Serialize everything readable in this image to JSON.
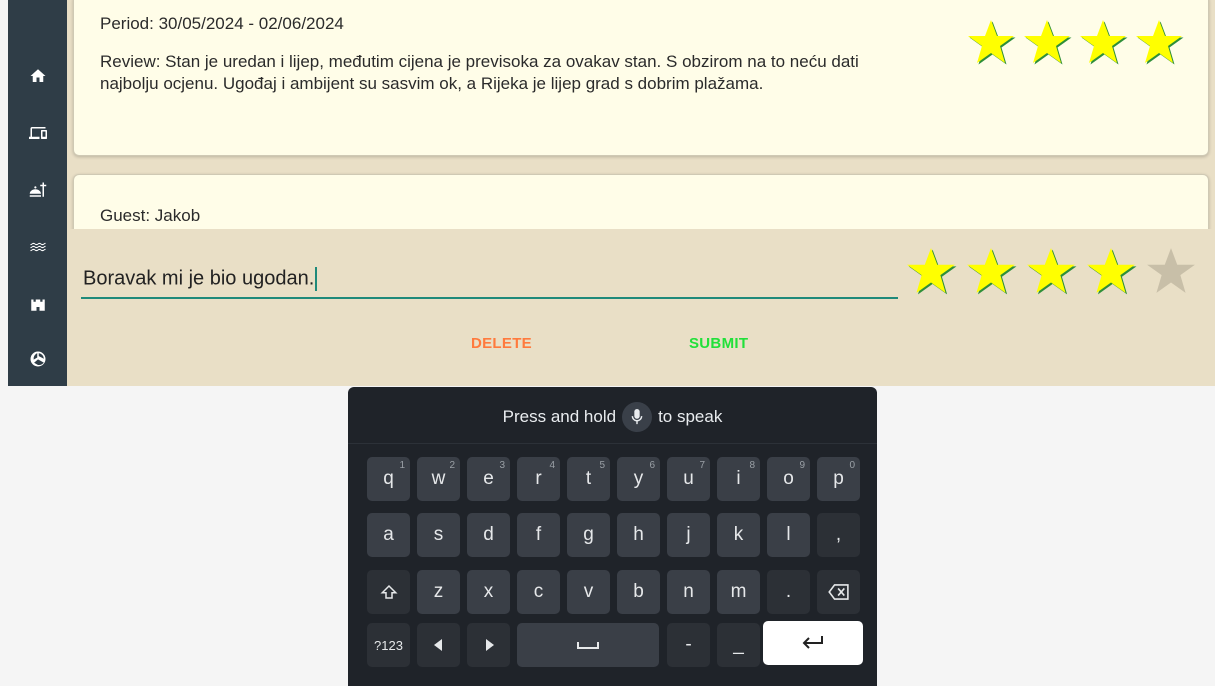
{
  "sidebar": {
    "icons": [
      "home-icon",
      "devices-icon",
      "restaurant-icon",
      "waves-icon",
      "castle-icon",
      "volleyball-icon"
    ]
  },
  "reviews": [
    {
      "period": "Period: 30/05/2024 - 02/06/2024",
      "review": "Review: Stan je uredan i lijep, međutim cijena je previsoka za ovakav stan. S obzirom na to neću dati najbolju ocjenu. Ugođaj i ambijent su sasvim ok, a Rijeka je lijep grad s dobrim plažama.",
      "rating": 4
    },
    {
      "guest": "Guest: Jakob"
    }
  ],
  "composer": {
    "text": "Boravak mi je bio ugodan.",
    "rating": 4,
    "max_rating": 5,
    "delete_label": "DELETE",
    "submit_label": "SUBMIT"
  },
  "colors": {
    "star_active": "#ffff00",
    "star_inactive": "#c8bfa8",
    "delete": "#ff7a3d",
    "submit": "#22e03a",
    "accent": "#1f8a7a"
  },
  "keyboard": {
    "hint_before": "Press and hold",
    "hint_after": "to speak",
    "row1": [
      [
        "q",
        "1"
      ],
      [
        "w",
        "2"
      ],
      [
        "e",
        "3"
      ],
      [
        "r",
        "4"
      ],
      [
        "t",
        "5"
      ],
      [
        "y",
        "6"
      ],
      [
        "u",
        "7"
      ],
      [
        "i",
        "8"
      ],
      [
        "o",
        "9"
      ],
      [
        "p",
        "0"
      ]
    ],
    "row2": [
      "a",
      "s",
      "d",
      "f",
      "g",
      "h",
      "j",
      "k",
      "l",
      ","
    ],
    "row3": [
      "z",
      "x",
      "c",
      "v",
      "b",
      "n",
      "m",
      "."
    ],
    "symbols_label": "?123",
    "dash": "-",
    "underscore": "_"
  }
}
